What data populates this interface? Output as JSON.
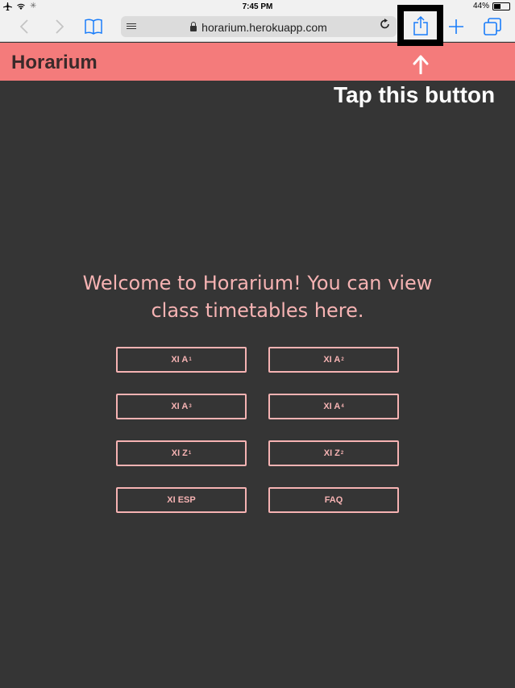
{
  "status_bar": {
    "time": "7:45 PM",
    "battery": "44%",
    "battery_level": 0.44
  },
  "browser": {
    "url": "horarium.herokuapp.com"
  },
  "app": {
    "title": "Horarium"
  },
  "annotation": {
    "text": "Tap this button"
  },
  "welcome": "Welcome to Horarium! You can view class timetables here.",
  "buttons": [
    {
      "label": "XI A",
      "sub": "1"
    },
    {
      "label": "XI A",
      "sub": "2"
    },
    {
      "label": "XI A",
      "sub": "3"
    },
    {
      "label": "XI A",
      "sub": "4"
    },
    {
      "label": "XI Z",
      "sub": "1"
    },
    {
      "label": "XI Z",
      "sub": "2"
    },
    {
      "label": "XI ESP",
      "sub": ""
    },
    {
      "label": "FAQ",
      "sub": ""
    }
  ],
  "colors": {
    "accent": "#f47b7b",
    "text_pink": "#f6b3b3",
    "background": "#353535",
    "ios_blue": "#1a7dfa"
  }
}
